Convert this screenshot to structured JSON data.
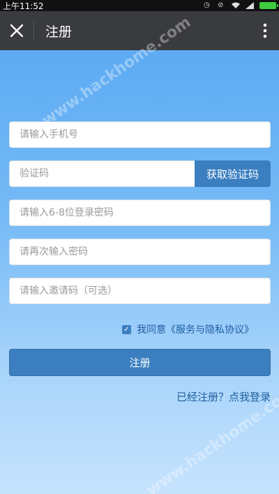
{
  "status_bar": {
    "time": "上午11:52"
  },
  "title_bar": {
    "title": "注册"
  },
  "form": {
    "phone_placeholder": "请输入手机号",
    "code_placeholder": "验证码",
    "get_code_label": "获取验证码",
    "password_placeholder": "请输入6-8位登录密码",
    "confirm_password_placeholder": "请再次输入密码",
    "invite_placeholder": "请输入邀请码（可选）",
    "agree_text": "我同意《服务与隐私协议》",
    "agree_checked": true,
    "register_label": "注册",
    "login_link": "已经注册？点我登录"
  },
  "watermark": {
    "text": "www.hackhome.com"
  },
  "colors": {
    "accent": "#3b7fc0",
    "title_bar_bg": "#3a3b3f",
    "link": "#1f5e9e"
  }
}
